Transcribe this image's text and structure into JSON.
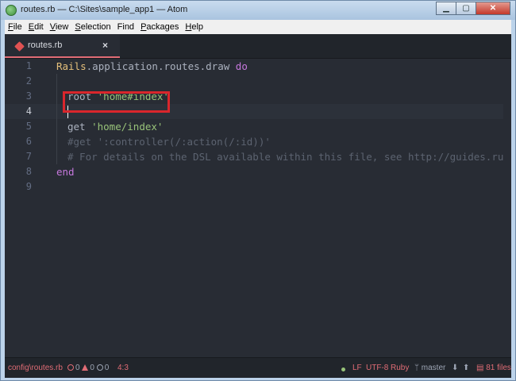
{
  "window": {
    "title": "routes.rb — C:\\Sites\\sample_app1 — Atom",
    "minimize_icon": "minimize-icon",
    "maximize_icon": "maximize-icon",
    "close_icon": "close-icon"
  },
  "menu": [
    {
      "label": "File",
      "accel": "F",
      "rest": "ile"
    },
    {
      "label": "Edit",
      "accel": "E",
      "rest": "dit"
    },
    {
      "label": "View",
      "accel": "V",
      "rest": "iew"
    },
    {
      "label": "Selection",
      "accel": "S",
      "rest": "election"
    },
    {
      "label": "Find",
      "accel": "F",
      "rest": "ind"
    },
    {
      "label": "Packages",
      "accel": "P",
      "rest": "ackages"
    },
    {
      "label": "Help",
      "accel": "H",
      "rest": "elp"
    }
  ],
  "tab": {
    "label": "routes.rb",
    "close_glyph": "×",
    "icon": "ruby-file-icon"
  },
  "line_numbers": [
    "1",
    "2",
    "3",
    "4",
    "5",
    "6",
    "7",
    "8",
    "9"
  ],
  "active_line": 4,
  "code": {
    "line1": {
      "cls": "Rails",
      "rest": ".application.routes.draw ",
      "kw": "do"
    },
    "line3": {
      "method": "root ",
      "str": "'home#index'"
    },
    "line5": {
      "method": "get ",
      "str": "'home/index'"
    },
    "line6": {
      "comment": "#get ':controller(/:action(/:id))'"
    },
    "line7": {
      "comment": "# For details on the DSL available within this file, see http://guides.rubyonrails"
    },
    "line8": {
      "kw": "end"
    }
  },
  "status": {
    "file_path": "config\\routes.rb",
    "errors": "0",
    "warnings": "0",
    "info": "0",
    "cursor_pos": "4:3",
    "line_ending": "LF",
    "encoding": "UTF-8",
    "grammar": "Ruby",
    "branch": "master",
    "files_changed": "81 files",
    "accent_color": "#e06c75"
  }
}
